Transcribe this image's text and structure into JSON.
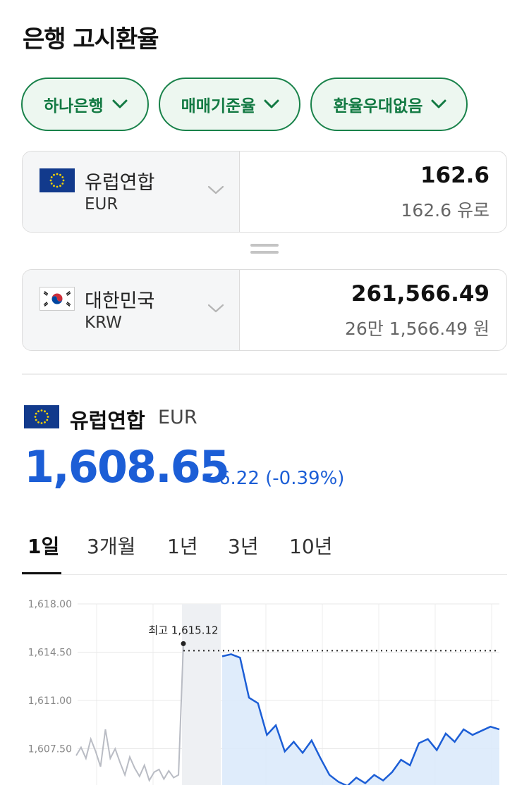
{
  "header": {
    "title": "은행 고시환율"
  },
  "filters": [
    {
      "label": "하나은행"
    },
    {
      "label": "매매기준율"
    },
    {
      "label": "환율우대없음"
    }
  ],
  "converter": {
    "from": {
      "name": "유럽연합",
      "code": "EUR",
      "value": "162.6",
      "value_text": "162.6 유로"
    },
    "to": {
      "name": "대한민국",
      "code": "KRW",
      "value": "261,566.49",
      "value_text": "26만 1,566.49 원"
    }
  },
  "detail": {
    "name": "유럽연합",
    "code": "EUR",
    "rate": "1,608.65",
    "change": "6.22 (-0.39%)",
    "direction": "down",
    "color": "#1c5ed6"
  },
  "periods": [
    {
      "label": "1일",
      "active": true
    },
    {
      "label": "3개월",
      "active": false
    },
    {
      "label": "1년",
      "active": false
    },
    {
      "label": "3년",
      "active": false
    },
    {
      "label": "10년",
      "active": false
    }
  ],
  "chart_data": {
    "type": "line",
    "ylim": [
      1605.0,
      1618.5
    ],
    "y_ticks": [
      "1,618.00",
      "1,614.50",
      "1,611.00",
      "1,607.50"
    ],
    "y_tick_values": [
      1618.0,
      1614.5,
      1611.0,
      1607.5
    ],
    "max_label": "최고 1,615.12",
    "max_value": 1615.12,
    "series": [
      {
        "color": "#b9bcc4",
        "values": [
          1607.0,
          1607.6,
          1606.8,
          1608.2,
          1607.3,
          1606.2,
          1608.9,
          1606.8,
          1607.5,
          1606.5,
          1605.6,
          1606.9,
          1606.1,
          1605.5,
          1606.3,
          1605.2,
          1605.8,
          1606.0,
          1605.3,
          1605.9,
          1605.4,
          1605.6,
          1615.12
        ]
      },
      {
        "color": "#1c5ed6",
        "fill": "#dbeafb",
        "values": [
          1614.2,
          1614.35,
          1614.1,
          1611.2,
          1610.8,
          1608.5,
          1609.2,
          1607.3,
          1608.0,
          1607.2,
          1608.1,
          1606.8,
          1605.6,
          1605.1,
          1604.8,
          1605.4,
          1605.0,
          1605.6,
          1605.2,
          1605.8,
          1606.7,
          1606.3,
          1607.9,
          1608.2,
          1607.4,
          1608.6,
          1608.0,
          1608.9,
          1608.5,
          1608.8,
          1609.1,
          1608.9
        ]
      }
    ]
  }
}
